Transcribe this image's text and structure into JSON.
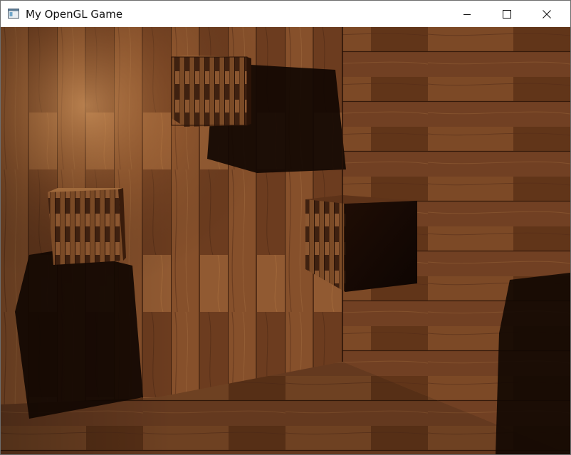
{
  "window": {
    "title": "My OpenGL Game",
    "app_icon": "window-app-icon",
    "controls": {
      "minimize_icon": "minimize-icon",
      "maximize_icon": "maximize-icon",
      "close_icon": "close-icon"
    }
  },
  "scene": {
    "description_icon": "3d-render-viewport",
    "colors": {
      "wood_light": "#a0653a",
      "wood_mid": "#6b3d1f",
      "wood_dark": "#3a1d0c",
      "shadow": "#150a04",
      "highlight": "#c8874f"
    }
  }
}
